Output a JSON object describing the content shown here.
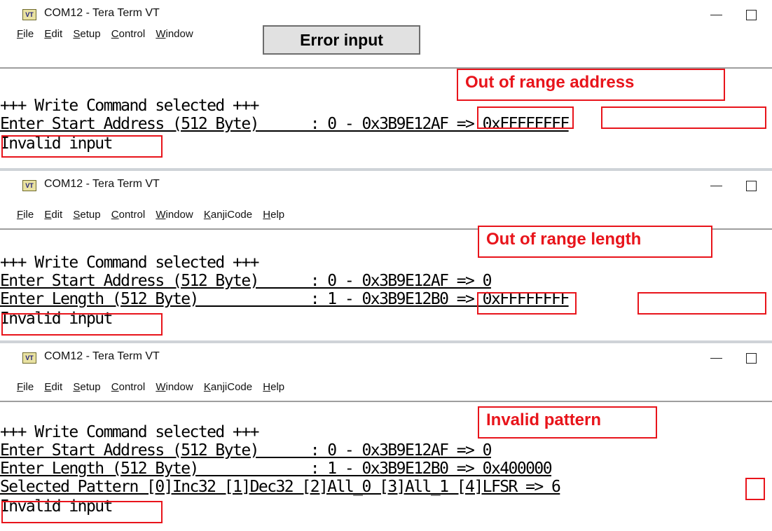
{
  "windows": [
    {
      "title": "COM12 - Tera Term VT",
      "menu": [
        "File",
        "Edit",
        "Setup",
        "Control",
        "Window"
      ],
      "lines": [
        "+++ Write Command selected +++",
        "Enter Start Address (512 Byte)      : 0 - 0x3B9E12AF => 0xFFFFFFFF",
        "Invalid input"
      ],
      "callout": "Out of range address"
    },
    {
      "title": "COM12 - Tera Term VT",
      "menu": [
        "File",
        "Edit",
        "Setup",
        "Control",
        "Window",
        "KanjiCode",
        "Help"
      ],
      "lines": [
        "+++ Write Command selected +++",
        "Enter Start Address (512 Byte)      : 0 - 0x3B9E12AF => 0",
        "Enter Length (512 Byte)             : 1 - 0x3B9E12B0 => 0xFFFFFFFF",
        "Invalid input"
      ],
      "callout": "Out of range length"
    },
    {
      "title": "COM12 - Tera Term VT",
      "menu": [
        "File",
        "Edit",
        "Setup",
        "Control",
        "Window",
        "KanjiCode",
        "Help"
      ],
      "lines": [
        "+++ Write Command selected +++",
        "Enter Start Address (512 Byte)      : 0 - 0x3B9E12AF => 0",
        "Enter Length (512 Byte)             : 1 - 0x3B9E12B0 => 0x400000",
        "Selected Pattern [0]Inc32 [1]Dec32 [2]All_0 [3]All_1 [4]LFSR => 6",
        "Invalid input"
      ],
      "callout": "Invalid pattern"
    }
  ],
  "overlay": {
    "error_tag": "Error input"
  },
  "app_icon_text": "VT",
  "colors": {
    "highlight": "#e8141b",
    "tag_bg": "#e1e1e1"
  }
}
